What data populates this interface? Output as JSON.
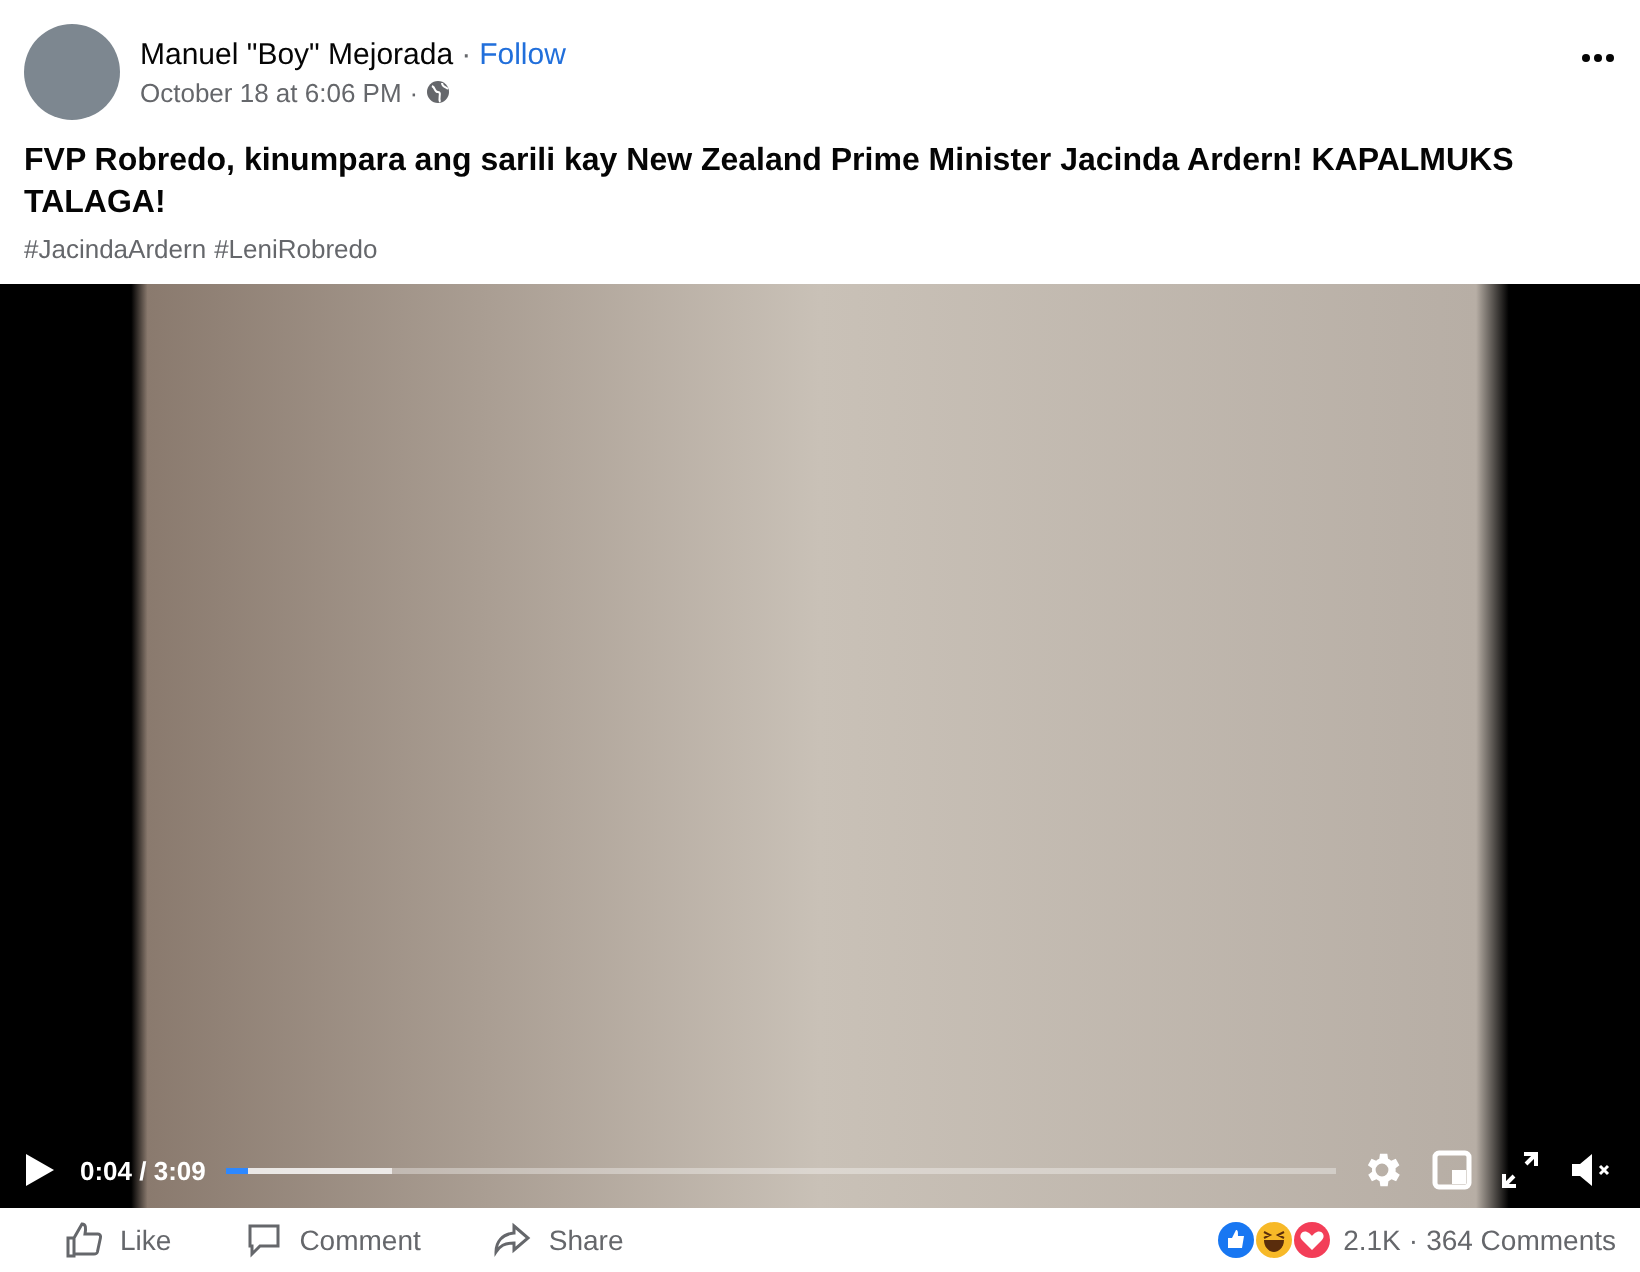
{
  "post": {
    "author": "Manuel \"Boy\" Mejorada",
    "separator": "·",
    "follow": "Follow",
    "timestamp": "October 18 at 6:06 PM",
    "timestamp_separator": "·",
    "text": "FVP Robredo, kinumpara ang sarili kay New Zealand Prime Minister Jacinda Ardern! KAPALMUKS TALAGA!",
    "hashtags": [
      "#JacindaArdern",
      "#LeniRobredo"
    ]
  },
  "video": {
    "time": "0:04 / 3:09",
    "level": 0.02,
    "muted": true
  },
  "actions": [
    {
      "kind": "like",
      "label": "Like"
    },
    {
      "kind": "comment",
      "label": "Comment"
    },
    {
      "kind": "share",
      "label": "Share"
    }
  ],
  "reactions": {
    "count": "2.1K",
    "separator": "·",
    "comments": "364 Comments"
  }
}
